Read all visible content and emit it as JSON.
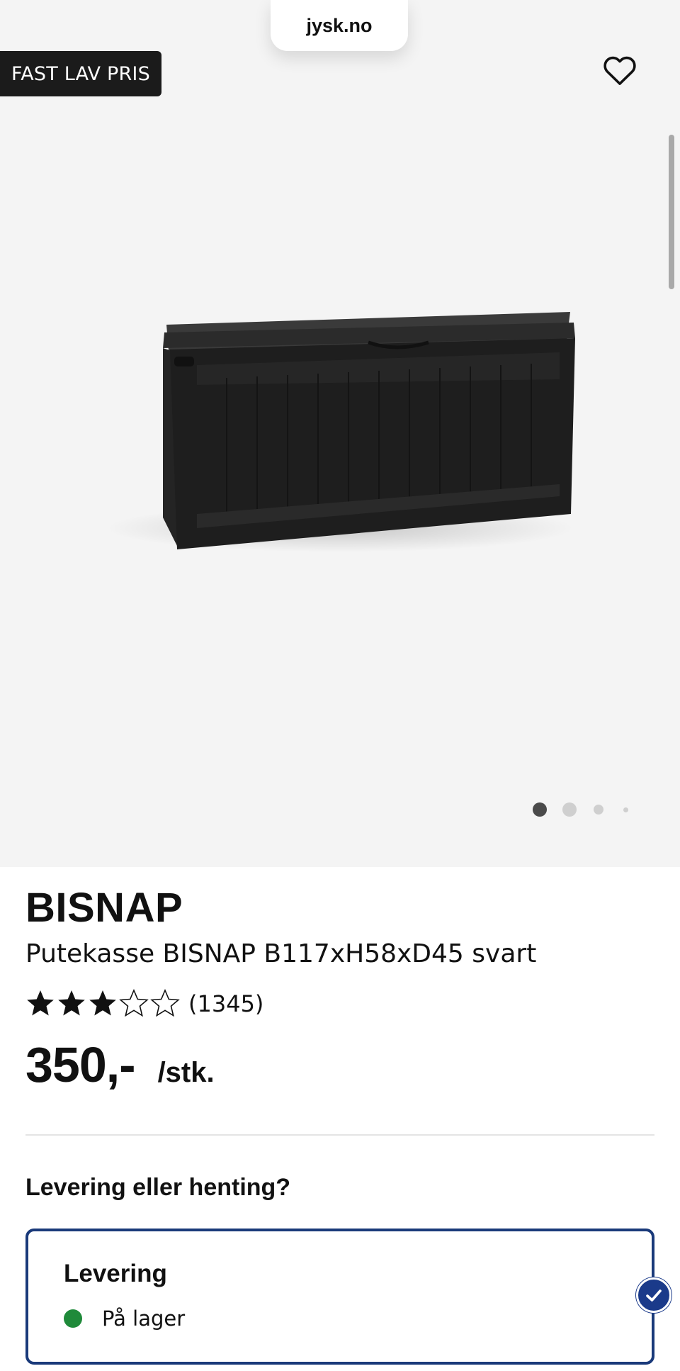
{
  "browser": {
    "url": "jysk.no"
  },
  "product": {
    "badge": "FAST LAV PRIS",
    "brand": "BISNAP",
    "name": "Putekasse BISNAP B117xH58xD45 svart",
    "rating": 3.5,
    "rating_max": 5,
    "review_count": "(1345)",
    "price": "350,-",
    "unit": "/stk.",
    "gallery": {
      "total_images": 4,
      "current_index": 1
    }
  },
  "delivery": {
    "question": "Levering eller henting?",
    "option": {
      "title": "Levering",
      "status": "På lager",
      "selected": true
    }
  },
  "colors": {
    "accent": "#1a3a8a",
    "in_stock": "#1f8a3a",
    "badge_bg": "#1b1b1b",
    "hero_bg": "#f4f4f4"
  },
  "icons": {
    "favorite": "heart-outline-icon",
    "rating": "star-icon",
    "selected": "checkmark-circle-icon"
  }
}
